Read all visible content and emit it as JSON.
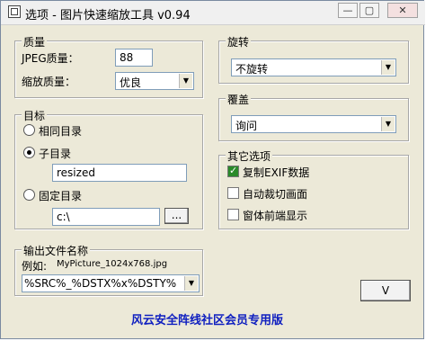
{
  "window": {
    "title": "选项 - 图片快速缩放工具 v0.94",
    "minimize_glyph": "—",
    "restore_glyph": "▢",
    "close_glyph": "✕"
  },
  "quality": {
    "group_title": "质量",
    "jpeg_label": "JPEG质量：",
    "jpeg_value": "88",
    "scale_label": "缩放质量：",
    "scale_value": "优良"
  },
  "target": {
    "group_title": "目标",
    "same_dir_label": "相同目录",
    "sub_dir_label": "子目录",
    "sub_dir_value": "resized",
    "fixed_dir_label": "固定目录",
    "fixed_dir_value": "c:\\",
    "browse_label": "..."
  },
  "output": {
    "group_title": "输出文件名称",
    "example_label": "例如:",
    "example_value": "MyPicture_1024x768.jpg",
    "pattern_value": "%SRC%_%DSTX%x%DSTY%"
  },
  "rotate": {
    "group_title": "旋转",
    "value": "不旋转"
  },
  "overwrite": {
    "group_title": "覆盖",
    "value": "询问"
  },
  "other": {
    "group_title": "其它选项",
    "copy_exif_label": "复制EXIF数据",
    "copy_exif_checked": true,
    "auto_crop_label": "自动裁切画面",
    "auto_crop_checked": false,
    "window_front_label": "窗体前端显示",
    "window_front_checked": false
  },
  "ok_button_label": "V",
  "footer_text": "风云安全阵线社区会员专用版",
  "icons": [
    "app-icon",
    "minimize-icon",
    "restore-icon",
    "close-icon",
    "chevron-down-icon"
  ]
}
